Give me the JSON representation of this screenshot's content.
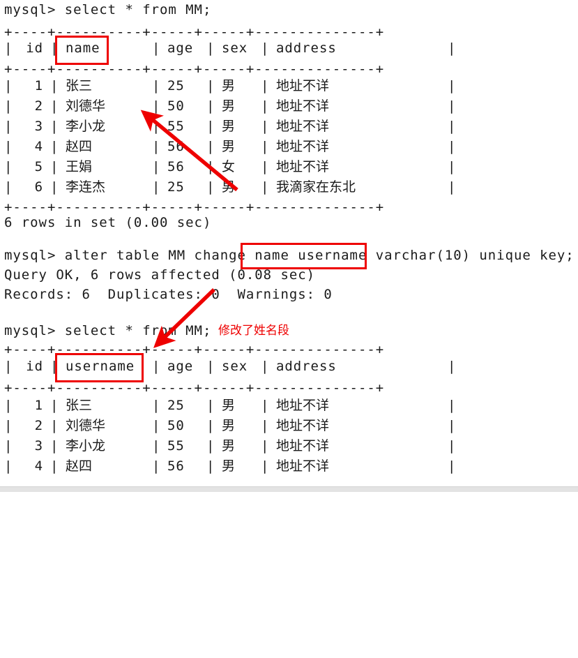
{
  "terminal": {
    "prompt": "mysql>",
    "commands": {
      "select_first": "mysql> select * from MM;",
      "alter": {
        "before": "mysql> alter table MM change ",
        "highlighted": "name username",
        "after": " varchar(10) unique key;",
        "full": "mysql> alter table MM change name username varchar(10) unique key;"
      },
      "query_ok": "Query OK, 6 rows affected (0.08 sec)",
      "records": "Records: 6  Duplicates: 0  Warnings: 0",
      "rows_in_set": "6 rows in set (0.00 sec)",
      "select_second": "mysql> select * from MM;"
    },
    "table_before": {
      "rule": "+----+----------+-----+-----+--------------+",
      "headers": [
        "id",
        "name",
        "age",
        "sex",
        "address"
      ],
      "rows": [
        {
          "id": "1",
          "name": "张三",
          "age": "25",
          "sex": "男",
          "address": "地址不详"
        },
        {
          "id": "2",
          "name": "刘德华",
          "age": "50",
          "sex": "男",
          "address": "地址不详"
        },
        {
          "id": "3",
          "name": "李小龙",
          "age": "55",
          "sex": "男",
          "address": "地址不详"
        },
        {
          "id": "4",
          "name": "赵四",
          "age": "56",
          "sex": "男",
          "address": "地址不详"
        },
        {
          "id": "5",
          "name": "王娟",
          "age": "56",
          "sex": "女",
          "address": "地址不详"
        },
        {
          "id": "6",
          "name": "李连杰",
          "age": "25",
          "sex": "男",
          "address": "我滴家在东北"
        }
      ]
    },
    "table_after": {
      "rule": "+----+----------+-----+-----+--------------+",
      "headers": [
        "id",
        "username",
        "age",
        "sex",
        "address"
      ],
      "rows": [
        {
          "id": "1",
          "name": "张三",
          "age": "25",
          "sex": "男",
          "address": "地址不详"
        },
        {
          "id": "2",
          "name": "刘德华",
          "age": "50",
          "sex": "男",
          "address": "地址不详"
        },
        {
          "id": "3",
          "name": "李小龙",
          "age": "55",
          "sex": "男",
          "address": "地址不详"
        },
        {
          "id": "4",
          "name": "赵四",
          "age": "56",
          "sex": "男",
          "address": "地址不详"
        }
      ]
    },
    "pipe": "|"
  },
  "annotations": {
    "note_text": "修改了姓名段",
    "highlight_color": "#ee0000",
    "arrow_color": "#ee0000",
    "boxes": [
      {
        "target": "name-header",
        "label": "name"
      },
      {
        "target": "alter-change-clause",
        "label": "name username"
      },
      {
        "target": "username-header",
        "label": "username"
      }
    ]
  }
}
